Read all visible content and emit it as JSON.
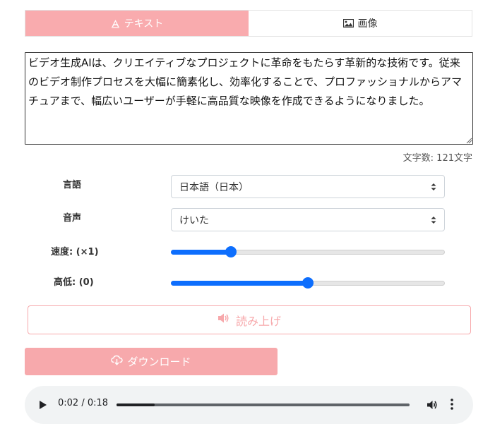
{
  "tabs": [
    {
      "label": "テキスト",
      "icon": "text-icon",
      "active": true
    },
    {
      "label": "画像",
      "icon": "image-icon",
      "active": false
    }
  ],
  "text_input": {
    "value": "ビデオ生成AIは、クリエイティブなプロジェクトに革命をもたらす革新的な技術です。従来のビデオ制作プロセスを大幅に簡素化し、効率化することで、プロファッショナルからアマチュアまで、幅広いユーザーが手軽に高品質な映像を作成できるようになりました。"
  },
  "char_count": "文字数: 121文字",
  "language": {
    "label": "言語",
    "value": "日本語（日本）"
  },
  "voice": {
    "label": "音声",
    "value": "けいた"
  },
  "speed": {
    "label": "速度: (×1)",
    "fraction": 0.22
  },
  "pitch": {
    "label": "高低: (0)",
    "fraction": 0.5
  },
  "read_button": {
    "label": "読み上げ",
    "icon": "speaker-icon"
  },
  "download_button": {
    "label": "ダウンロード",
    "icon": "cloud-download-icon"
  },
  "audio": {
    "time": "0:02 / 0:18",
    "progress": 0.13
  },
  "colors": {
    "accent_pink": "#f7a9ac",
    "slider_blue": "#0d6efd"
  }
}
